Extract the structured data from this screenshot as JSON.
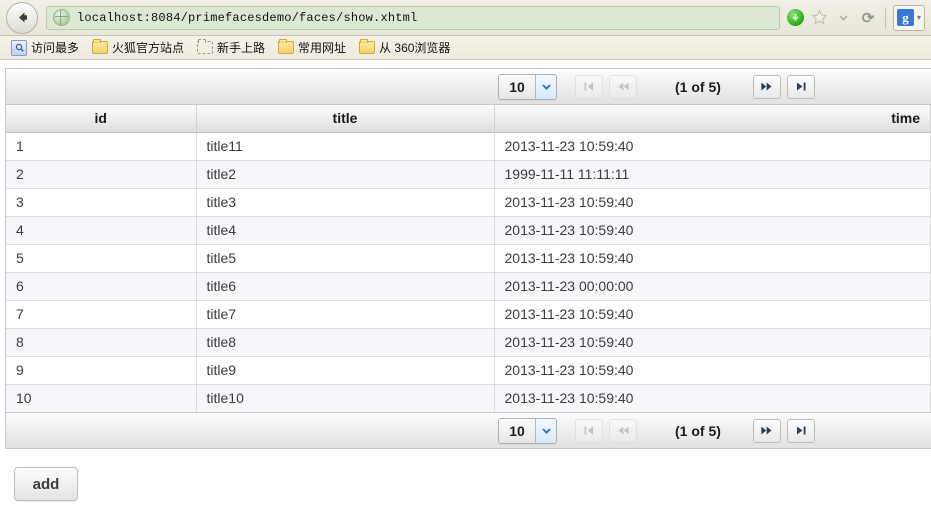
{
  "browser": {
    "back_label": "Back",
    "url": "localhost:8084/primefacesdemo/faces/show.xhtml",
    "reload_glyph": "⟳",
    "google_label": "g",
    "google_caret": "▾",
    "bookmarks": [
      {
        "label": "访问最多",
        "icon": "smart-bookmark-icon"
      },
      {
        "label": "火狐官方站点",
        "icon": "folder-icon"
      },
      {
        "label": "新手上路",
        "icon": "folder-dashed-icon"
      },
      {
        "label": "常用网址",
        "icon": "folder-icon"
      },
      {
        "label": "从 360浏览器",
        "icon": "folder-icon"
      }
    ]
  },
  "paginator": {
    "rows_per_page": "10",
    "current_page_label": "(1 of 5)",
    "first_title": "First Page",
    "prev_title": "Previous Page",
    "next_title": "Next Page",
    "last_title": "Last Page"
  },
  "table": {
    "columns": [
      {
        "key": "id",
        "label": "id"
      },
      {
        "key": "title",
        "label": "title"
      },
      {
        "key": "time",
        "label": "time"
      }
    ],
    "rows": [
      {
        "id": "1",
        "title": "title11",
        "time": "2013-11-23 10:59:40"
      },
      {
        "id": "2",
        "title": "title2",
        "time": "1999-11-11 11:11:11"
      },
      {
        "id": "3",
        "title": "title3",
        "time": "2013-11-23 10:59:40"
      },
      {
        "id": "4",
        "title": "title4",
        "time": "2013-11-23 10:59:40"
      },
      {
        "id": "5",
        "title": "title5",
        "time": "2013-11-23 10:59:40"
      },
      {
        "id": "6",
        "title": "title6",
        "time": "2013-11-23 00:00:00"
      },
      {
        "id": "7",
        "title": "title7",
        "time": "2013-11-23 10:59:40"
      },
      {
        "id": "8",
        "title": "title8",
        "time": "2013-11-23 10:59:40"
      },
      {
        "id": "9",
        "title": "title9",
        "time": "2013-11-23 10:59:40"
      },
      {
        "id": "10",
        "title": "title10",
        "time": "2013-11-23 10:59:40"
      }
    ]
  },
  "actions": {
    "add_label": "add"
  },
  "colors": {
    "urlbar_bg": "#dbe8d4",
    "chrome_bg": "#f2f0e6",
    "row_alt": "#f6f7fb",
    "google_blue": "#3b78d8",
    "download_green": "#33b022"
  }
}
